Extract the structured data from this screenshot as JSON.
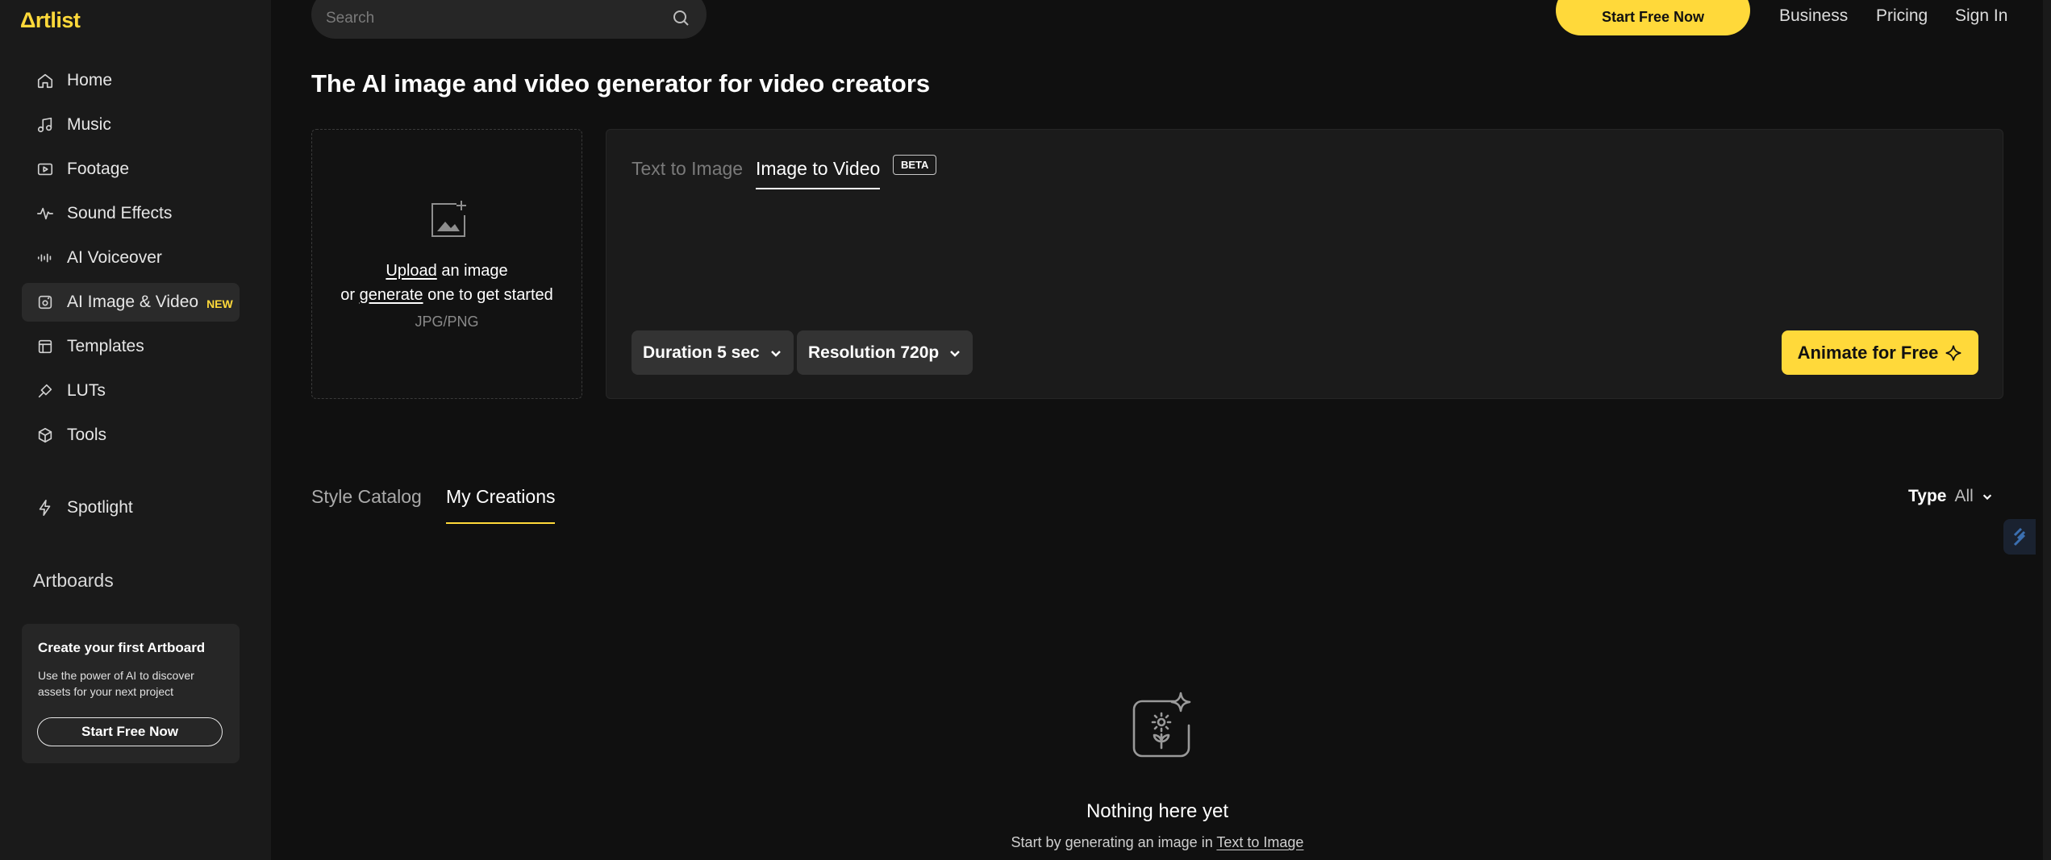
{
  "brand": {
    "logo": "Δrtlist",
    "accent": "#ffd93a"
  },
  "sidebar": {
    "items": [
      {
        "label": "Home",
        "icon": "home-icon"
      },
      {
        "label": "Music",
        "icon": "music-icon"
      },
      {
        "label": "Footage",
        "icon": "footage-icon"
      },
      {
        "label": "Sound Effects",
        "icon": "sound-effects-icon"
      },
      {
        "label": "AI Voiceover",
        "icon": "voiceover-icon"
      },
      {
        "label": "AI Image & Video",
        "icon": "ai-image-icon",
        "badge": "NEW",
        "active": true
      },
      {
        "label": "Templates",
        "icon": "templates-icon"
      },
      {
        "label": "LUTs",
        "icon": "luts-icon"
      },
      {
        "label": "Tools",
        "icon": "tools-icon"
      },
      {
        "label": "Spotlight",
        "icon": "lightning-icon"
      }
    ],
    "artboards_title": "Artboards",
    "artboard_card": {
      "title": "Create your first Artboard",
      "text": "Use the power of AI to discover assets for your next project",
      "button": "Start Free Now"
    }
  },
  "header": {
    "search_placeholder": "Search",
    "cta": "Start Free Now",
    "links": [
      "Business",
      "Pricing",
      "Sign In"
    ]
  },
  "main": {
    "title": "The AI image and video generator for video creators",
    "upload": {
      "link_upload": "Upload",
      "text_after_upload": "an image",
      "text_or": "or",
      "link_generate": "generate",
      "text_after_generate": "one to get started",
      "formats": "JPG/PNG"
    },
    "generator": {
      "tabs": [
        {
          "label": "Text to Image",
          "active": false
        },
        {
          "label": "Image to Video",
          "active": true
        }
      ],
      "beta_badge": "BETA",
      "duration": "Duration 5 sec",
      "resolution": "Resolution 720p",
      "animate_button": "Animate for Free"
    },
    "library_tabs": [
      {
        "label": "Style Catalog",
        "active": false
      },
      {
        "label": "My Creations",
        "active": true
      }
    ],
    "type_filter": {
      "label": "Type",
      "value": "All"
    },
    "empty_state": {
      "title": "Nothing here yet",
      "subtitle": "Start by generating an image in",
      "link": "Text to Image"
    }
  }
}
